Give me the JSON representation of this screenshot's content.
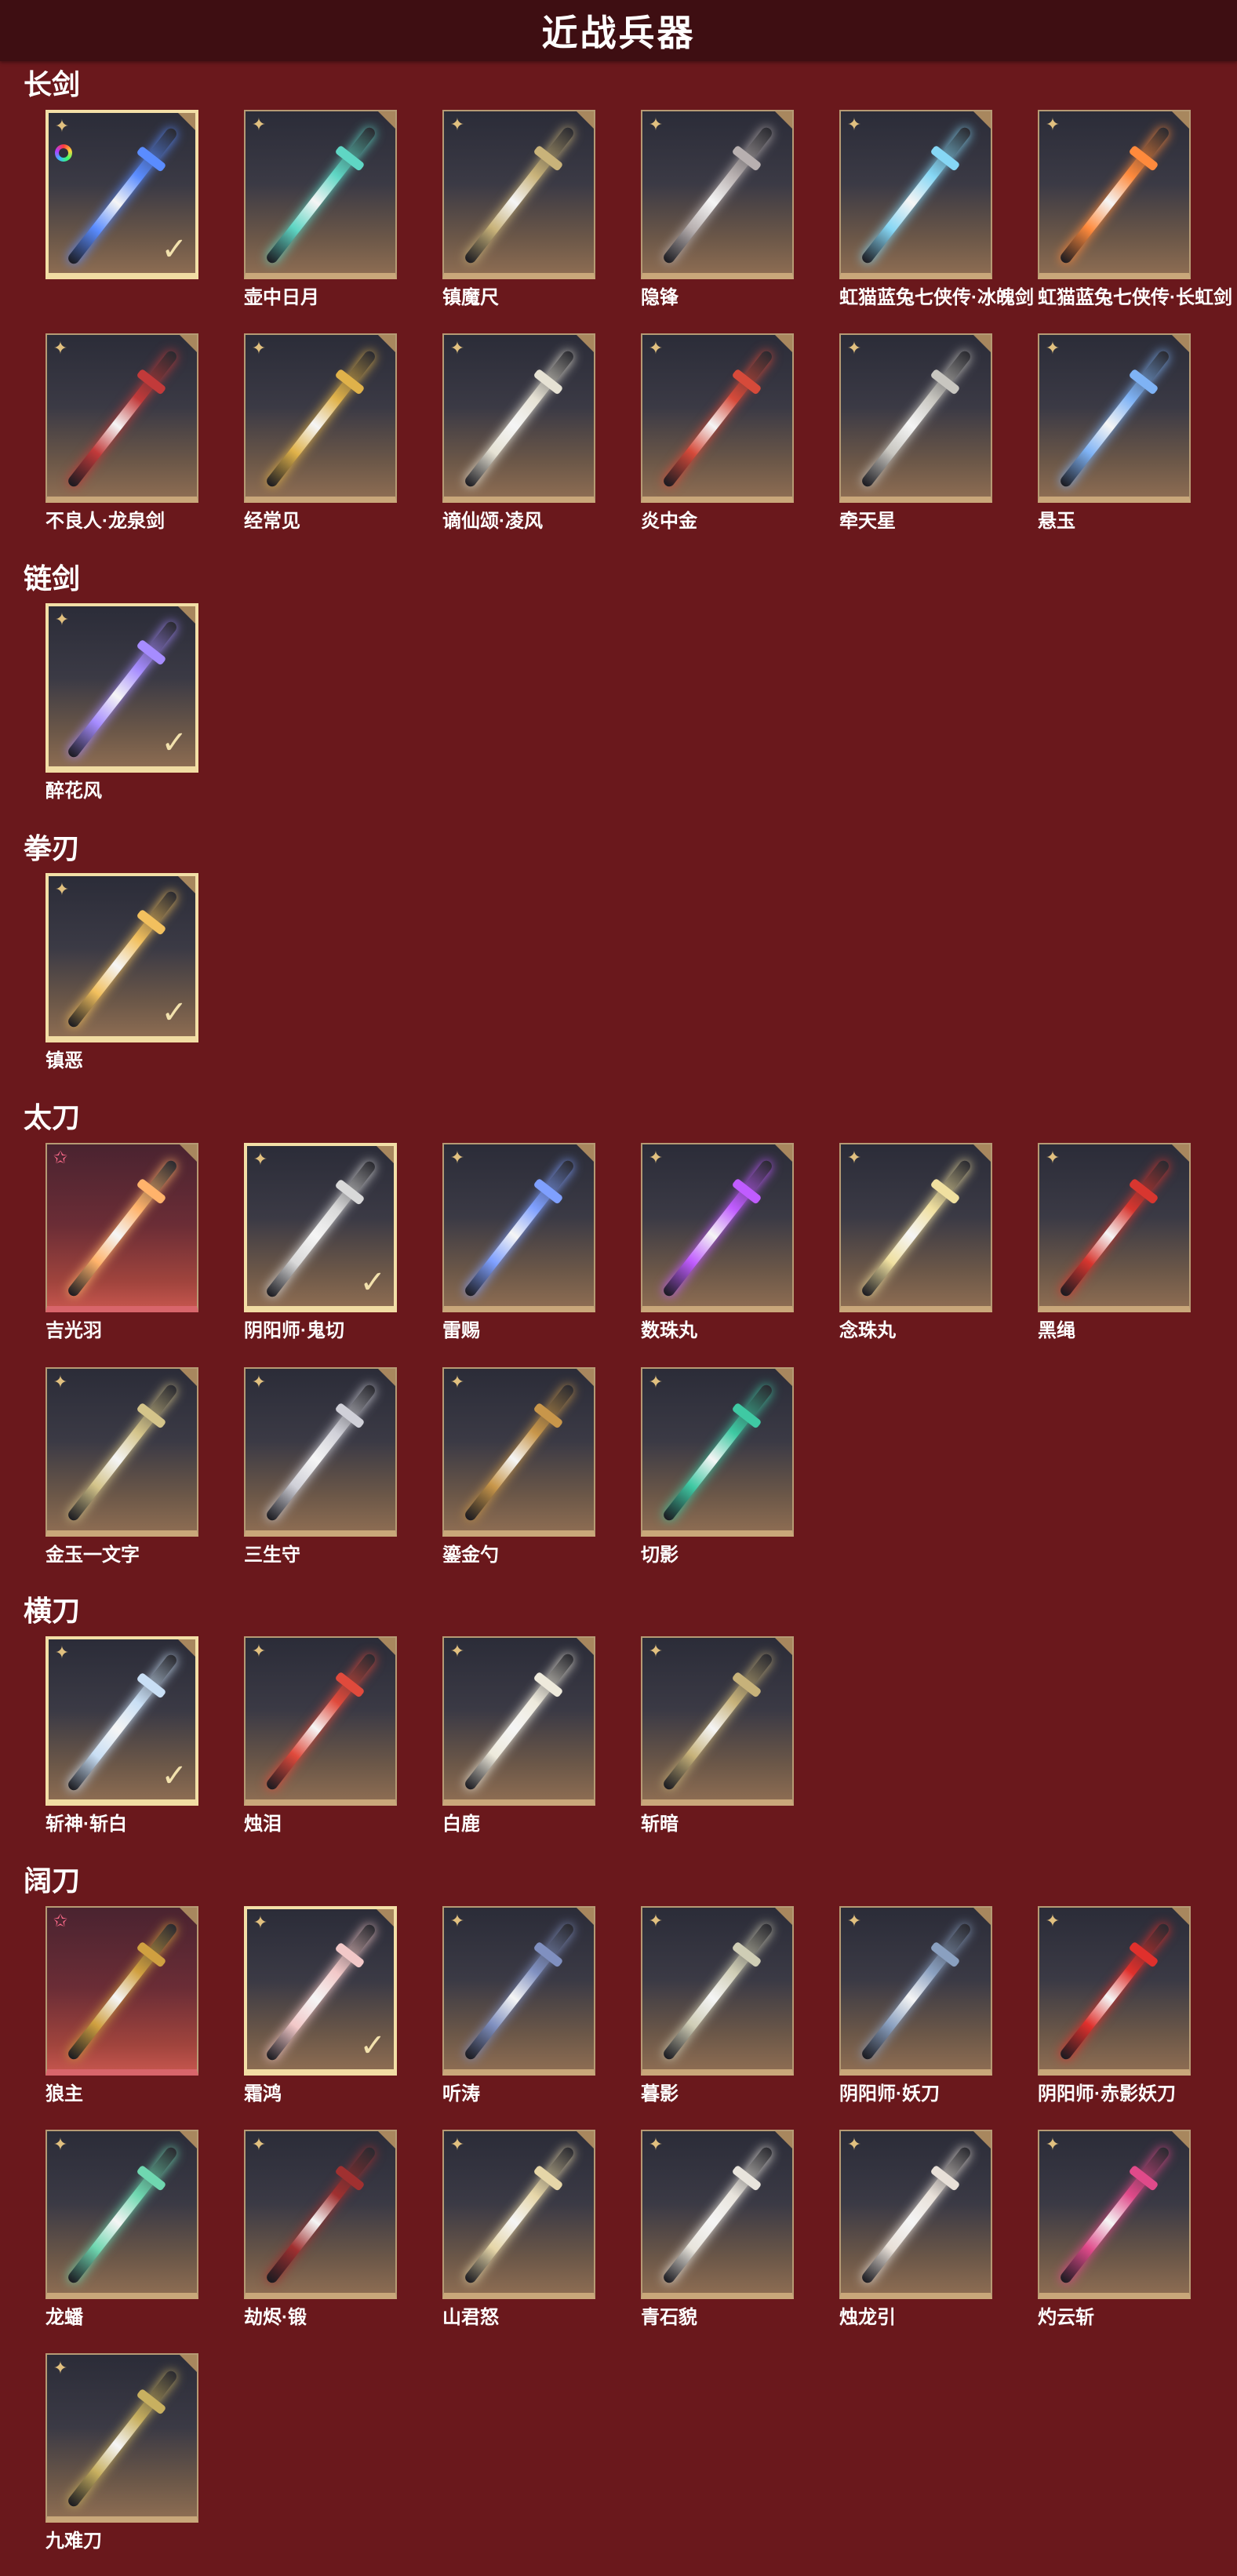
{
  "title": "近战兵器",
  "icons": {
    "normal": "shuriken-star-icon",
    "rare": "pink-star-icon",
    "equipped": "checkmark-icon",
    "color_variant": "rainbow-ring-icon"
  },
  "colors": {
    "background": "#6a181c",
    "header": "#3e0e12",
    "card_border": "#c9a77a",
    "selected_border": "#f3dfa7",
    "rare_bottom": "#d8656b"
  },
  "sections": [
    {
      "name": "长剑",
      "items": [
        {
          "label": "",
          "selected": true,
          "rare": false,
          "ring": true,
          "color": "#5a8cff"
        },
        {
          "label": "壶中日月",
          "selected": false,
          "rare": false,
          "ring": false,
          "color": "#5fd6c4"
        },
        {
          "label": "镇魔尺",
          "selected": false,
          "rare": false,
          "ring": false,
          "color": "#c9b37a"
        },
        {
          "label": "隐锋",
          "selected": false,
          "rare": false,
          "ring": false,
          "color": "#b8b0b0"
        },
        {
          "label": "虹猫蓝兔七侠传·冰魄剑",
          "selected": false,
          "rare": false,
          "ring": false,
          "color": "#86d7f5"
        },
        {
          "label": "虹猫蓝兔七侠传·长虹剑",
          "selected": false,
          "rare": false,
          "ring": false,
          "color": "#ff8a3c"
        },
        {
          "label": "不良人·龙泉剑",
          "selected": false,
          "rare": false,
          "ring": false,
          "color": "#c23a3a"
        },
        {
          "label": "经常见",
          "selected": false,
          "rare": false,
          "ring": false,
          "color": "#e0b24a"
        },
        {
          "label": "谪仙颂·凌风",
          "selected": false,
          "rare": false,
          "ring": false,
          "color": "#e6e2d4"
        },
        {
          "label": "炎中金",
          "selected": false,
          "rare": false,
          "ring": false,
          "color": "#d64a3a"
        },
        {
          "label": "牵天星",
          "selected": false,
          "rare": false,
          "ring": false,
          "color": "#c8c6c0"
        },
        {
          "label": "悬玉",
          "selected": false,
          "rare": false,
          "ring": false,
          "color": "#7fb3f5"
        }
      ]
    },
    {
      "name": "链剑",
      "items": [
        {
          "label": "醉花风",
          "selected": true,
          "rare": false,
          "ring": false,
          "color": "#a68cff"
        }
      ]
    },
    {
      "name": "拳刃",
      "items": [
        {
          "label": "镇恶",
          "selected": true,
          "rare": false,
          "ring": false,
          "color": "#f2c05e"
        }
      ]
    },
    {
      "name": "太刀",
      "items": [
        {
          "label": "吉光羽",
          "selected": false,
          "rare": true,
          "ring": false,
          "color": "#ffb36b"
        },
        {
          "label": "阴阳师·鬼切",
          "selected": true,
          "rare": false,
          "ring": false,
          "color": "#d9d9d9"
        },
        {
          "label": "雷赐",
          "selected": false,
          "rare": false,
          "ring": false,
          "color": "#7fa0ff"
        },
        {
          "label": "数珠丸",
          "selected": false,
          "rare": false,
          "ring": false,
          "color": "#c05cff"
        },
        {
          "label": "念珠丸",
          "selected": false,
          "rare": false,
          "ring": false,
          "color": "#f0e0a0"
        },
        {
          "label": "黑绳",
          "selected": false,
          "rare": false,
          "ring": false,
          "color": "#d8362f"
        },
        {
          "label": "金玉一文字",
          "selected": false,
          "rare": false,
          "ring": false,
          "color": "#d4c48a"
        },
        {
          "label": "三生守",
          "selected": false,
          "rare": false,
          "ring": false,
          "color": "#d0d0d8"
        },
        {
          "label": "鎏金勺",
          "selected": false,
          "rare": false,
          "ring": false,
          "color": "#c8964a"
        },
        {
          "label": "切影",
          "selected": false,
          "rare": false,
          "ring": false,
          "color": "#3fc9a3"
        }
      ]
    },
    {
      "name": "横刀",
      "items": [
        {
          "label": "斩神·斩白",
          "selected": true,
          "rare": false,
          "ring": false,
          "color": "#c9dff5"
        },
        {
          "label": "烛泪",
          "selected": false,
          "rare": false,
          "ring": false,
          "color": "#e04a3c"
        },
        {
          "label": "白鹿",
          "selected": false,
          "rare": false,
          "ring": false,
          "color": "#eeeadc"
        },
        {
          "label": "斩暗",
          "selected": false,
          "rare": false,
          "ring": false,
          "color": "#c7b27a"
        }
      ]
    },
    {
      "name": "阔刀",
      "items": [
        {
          "label": "狼主",
          "selected": false,
          "rare": true,
          "ring": false,
          "color": "#d0a040"
        },
        {
          "label": "霜鸿",
          "selected": true,
          "rare": false,
          "ring": false,
          "color": "#f2c8c8"
        },
        {
          "label": "听涛",
          "selected": false,
          "rare": false,
          "ring": false,
          "color": "#8090c0"
        },
        {
          "label": "暮影",
          "selected": false,
          "rare": false,
          "ring": false,
          "color": "#cfcdb5"
        },
        {
          "label": "阴阳师·妖刀",
          "selected": false,
          "rare": false,
          "ring": false,
          "color": "#8aa0c0"
        },
        {
          "label": "阴阳师·赤影妖刀",
          "selected": false,
          "rare": false,
          "ring": false,
          "color": "#e0302c"
        },
        {
          "label": "龙蟠",
          "selected": false,
          "rare": false,
          "ring": false,
          "color": "#6fd7b0"
        },
        {
          "label": "劫烬·锻",
          "selected": false,
          "rare": false,
          "ring": false,
          "color": "#a03030"
        },
        {
          "label": "山君怒",
          "selected": false,
          "rare": false,
          "ring": false,
          "color": "#e6d6a8"
        },
        {
          "label": "青石貌",
          "selected": false,
          "rare": false,
          "ring": false,
          "color": "#e8e4dc"
        },
        {
          "label": "烛龙引",
          "selected": false,
          "rare": false,
          "ring": false,
          "color": "#e8e0d8"
        },
        {
          "label": "灼云斩",
          "selected": false,
          "rare": false,
          "ring": false,
          "color": "#e04a8a"
        },
        {
          "label": "九难刀",
          "selected": false,
          "rare": false,
          "ring": false,
          "color": "#c8b060"
        }
      ]
    }
  ]
}
